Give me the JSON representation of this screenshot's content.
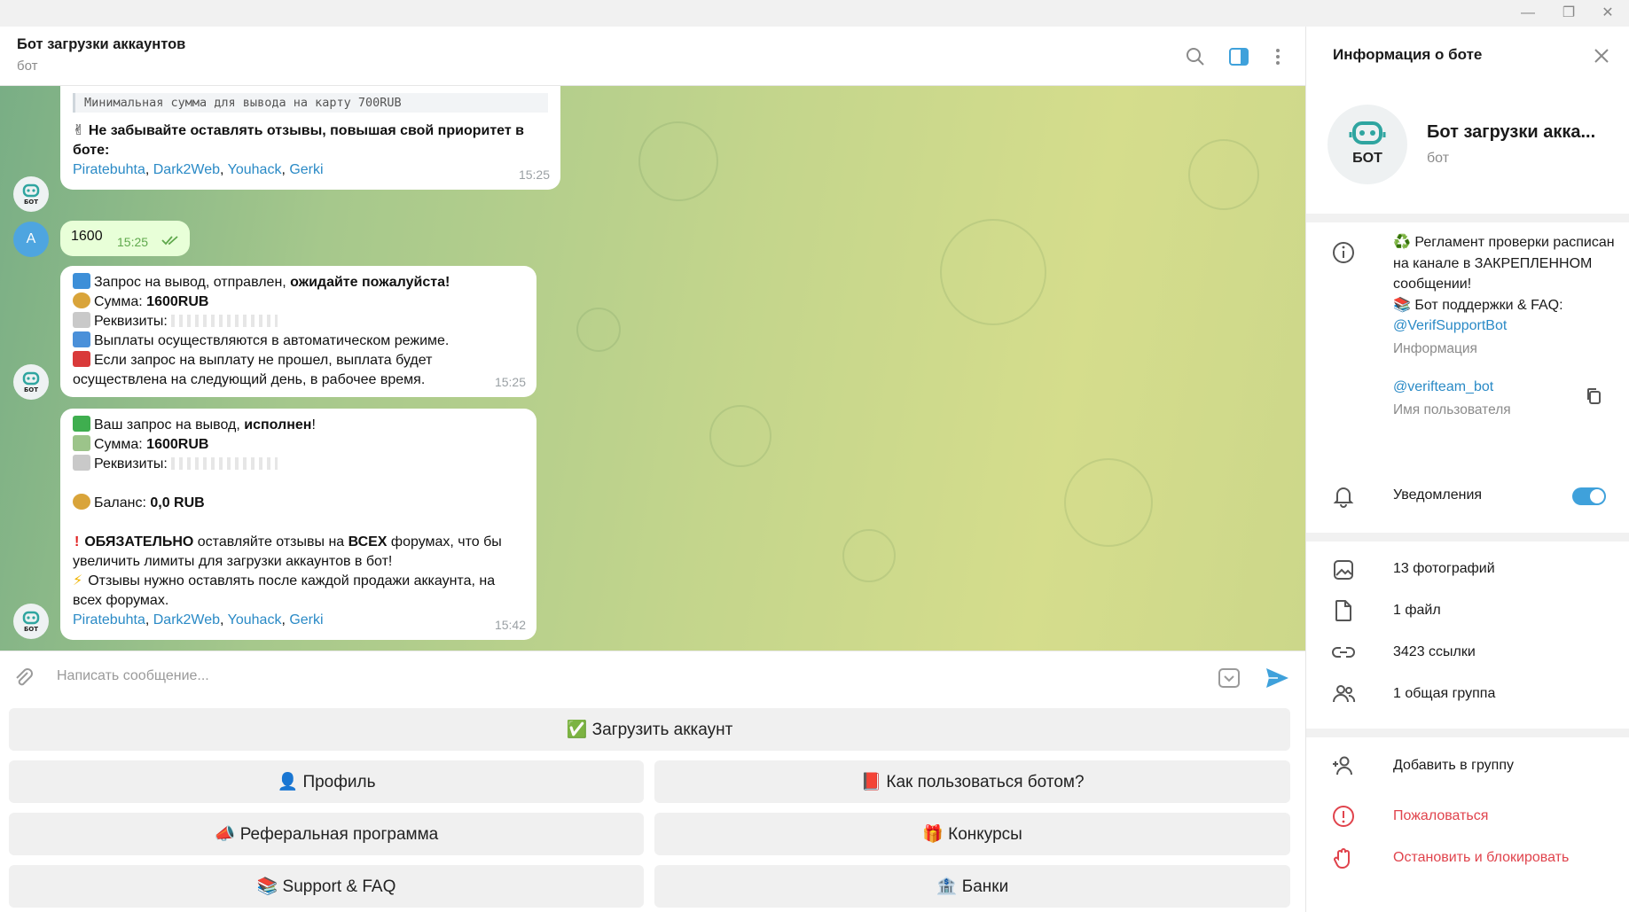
{
  "window": {
    "minimize": "—",
    "restore": "❐",
    "close": "✕"
  },
  "header": {
    "title": "Бот загрузки аккаунтов",
    "subtitle": "бот"
  },
  "messages": {
    "m1": {
      "note": "Минимальная сумма для вывода на карту 700RUB",
      "text_icon": "✌",
      "bold": "Не забывайте оставлять отзывы, повышая свой приоритет в боте:",
      "links": [
        "Piratebuhta",
        "Dark2Web",
        "Youhack",
        "Gerki"
      ],
      "time": "15:25"
    },
    "m2": {
      "avatar_letter": "A",
      "text": "1600",
      "time": "15:25"
    },
    "m3": {
      "l1a": "Запрос на вывод,  отправлен, ",
      "l1b": "ожидайте пожалуйста!",
      "l2a": "Сумма: ",
      "l2b": "1600RUB",
      "l3a": "Реквизиты: ",
      "l4": "Выплаты осуществляются в автоматическом режиме.",
      "l5": "Если запрос на выплату не прошел, выплата будет осуществлена на следующий день, в рабочее время.",
      "time": "15:25"
    },
    "m4": {
      "l1a": "Ваш запрос на вывод, ",
      "l1b": "исполнен",
      "l1c": "!",
      "l2a": "Сумма: ",
      "l2b": "1600RUB",
      "l3a": "Реквизиты: ",
      "l4a": "Баланс: ",
      "l4b": "0,0 RUB",
      "l5a": "ОБЯЗАТЕЛЬНО",
      "l5b": " оставляйте отзывы на ",
      "l5c": "ВСЕХ",
      "l5d": " форумах, что бы увеличить лимиты для загрузки аккаунтов в бот!",
      "l6": "Отзывы нужно оставлять после каждой продажи аккаунта, на всех форумах.",
      "links": [
        "Piratebuhta",
        "Dark2Web",
        "Youhack",
        "Gerki"
      ],
      "time": "15:42"
    }
  },
  "composer": {
    "placeholder": "Написать сообщение..."
  },
  "keyboard": {
    "upload": "✅ Загрузить аккаунт",
    "profile": "👤 Профиль",
    "howto": "📕 Как пользоваться ботом?",
    "referral": "📣 Реферальная программа",
    "contests": "🎁 Конкурсы",
    "support": "📚 Support & FAQ",
    "banks": "🏦 Банки"
  },
  "panel": {
    "title": "Информация о боте",
    "name": "Бот загрузки акка...",
    "subtitle": "бот",
    "avatar_text": "БОТ",
    "desc_l1": "♻️ Регламент проверки расписан на канале в ЗАКРЕПЛЕННОМ сообщении!",
    "desc_l2": "📚 Бот поддержки & FAQ:",
    "desc_link": "@VerifSupportBot",
    "desc_caption": "Информация",
    "username": "@verifteam_bot",
    "username_caption": "Имя пользователя",
    "notifications": "Уведомления",
    "notifications_on": true,
    "photos": "13 фотографий",
    "files": "1 файл",
    "links": "3423 ссылки",
    "groups": "1 общая группа",
    "add_to_group": "Добавить в группу",
    "report": "Пожаловаться",
    "block": "Остановить и блокировать"
  },
  "colors": {
    "accent": "#2a8ac6",
    "danger": "#e0434c",
    "toggle": "#3fa1db"
  }
}
